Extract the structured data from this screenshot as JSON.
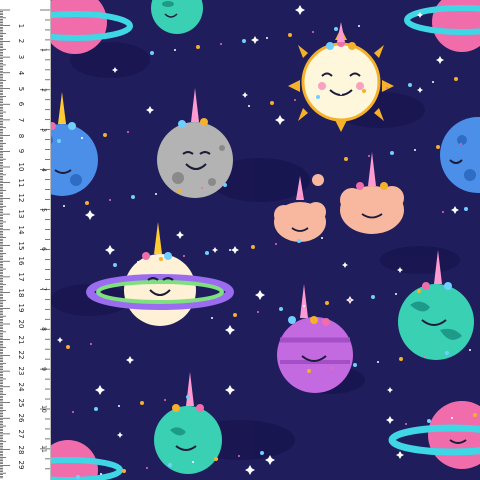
{
  "image": {
    "subject": "fabric swatch",
    "colors": {
      "background": "#1f1d5c",
      "background_dark": "#181650",
      "ruler": "#ffffff"
    }
  },
  "ruler": {
    "cm_labels": [
      "1",
      "2",
      "3",
      "4",
      "5",
      "6",
      "7",
      "8",
      "9",
      "10",
      "11",
      "12",
      "13",
      "14",
      "15",
      "16",
      "17",
      "18",
      "19",
      "20",
      "21",
      "22",
      "23",
      "24",
      "25",
      "26",
      "27",
      "28",
      "29",
      "30"
    ],
    "inch_labels": [
      "1",
      "2",
      "3",
      "4",
      "5",
      "6",
      "7",
      "8",
      "9",
      "10",
      "11",
      "12"
    ]
  }
}
